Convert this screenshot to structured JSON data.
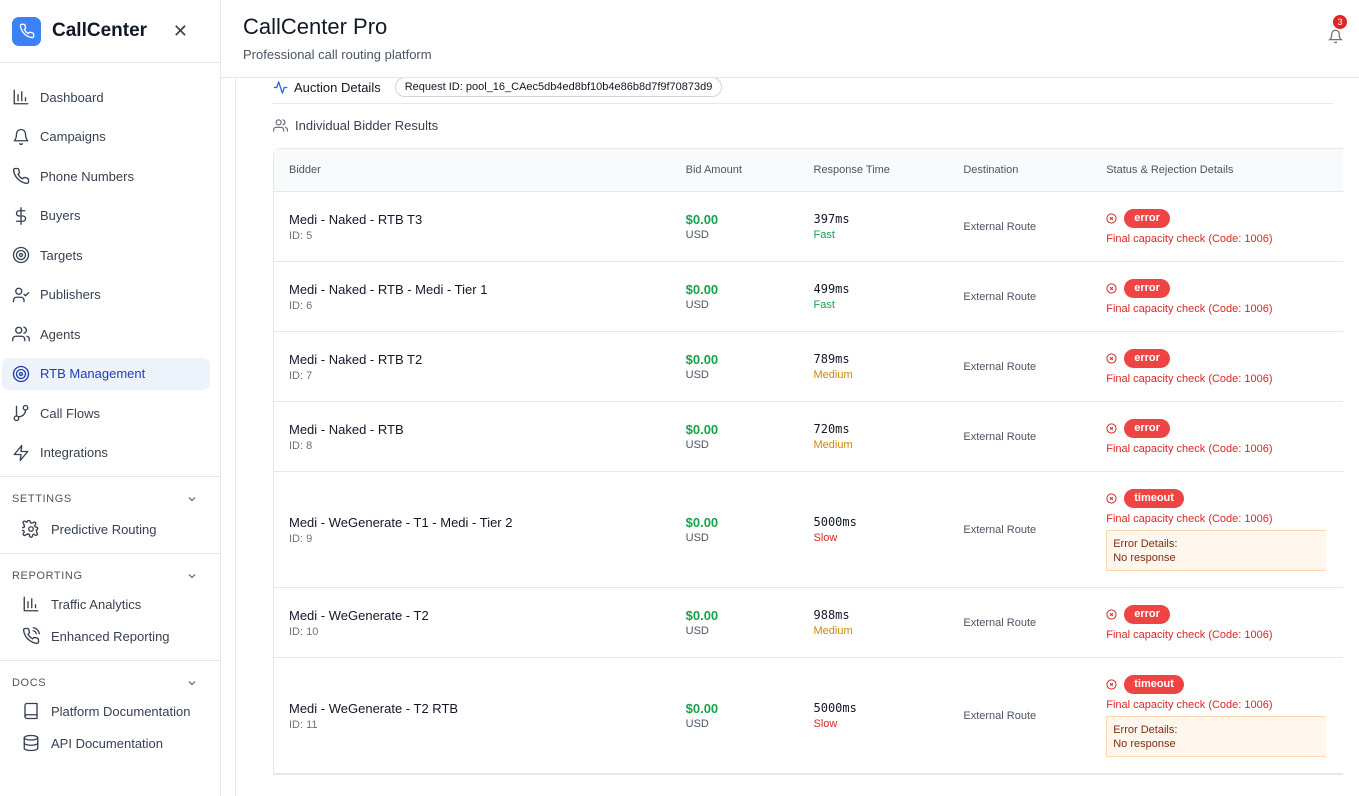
{
  "sidebar": {
    "brand": "CallCenter",
    "nav": [
      {
        "label": "Dashboard",
        "icon": "bar-chart-icon",
        "active": false
      },
      {
        "label": "Campaigns",
        "icon": "bell-icon",
        "active": false
      },
      {
        "label": "Phone Numbers",
        "icon": "phone-icon",
        "active": false
      },
      {
        "label": "Buyers",
        "icon": "dollar-icon",
        "active": false
      },
      {
        "label": "Targets",
        "icon": "target-icon",
        "active": false
      },
      {
        "label": "Publishers",
        "icon": "user-check-icon",
        "active": false
      },
      {
        "label": "Agents",
        "icon": "users-icon",
        "active": false
      },
      {
        "label": "RTB Management",
        "icon": "target-icon",
        "active": true
      },
      {
        "label": "Call Flows",
        "icon": "git-branch-icon",
        "active": false
      },
      {
        "label": "Integrations",
        "icon": "zap-icon",
        "active": false
      }
    ],
    "settings": {
      "title": "SETTINGS",
      "items": [
        {
          "label": "Predictive Routing",
          "icon": "gear-icon"
        }
      ]
    },
    "reporting": {
      "title": "REPORTING",
      "items": [
        {
          "label": "Traffic Analytics",
          "icon": "bar-chart-icon"
        },
        {
          "label": "Enhanced Reporting",
          "icon": "phone-call-icon"
        }
      ]
    },
    "docs": {
      "title": "DOCS",
      "items": [
        {
          "label": "Platform Documentation",
          "icon": "book-icon"
        },
        {
          "label": "API Documentation",
          "icon": "database-icon"
        }
      ]
    }
  },
  "header": {
    "title": "CallCenter Pro",
    "subtitle": "Professional call routing platform",
    "notification_count": "3"
  },
  "auction": {
    "title": "Auction Details",
    "request_id": "Request ID: pool_16_CAec5db4ed8bf10b4e86b8d7f9f70873d9",
    "results_title": "Individual Bidder Results"
  },
  "table": {
    "columns": [
      "Bidder",
      "Bid Amount",
      "Response Time",
      "Destination",
      "Status & Rejection Details"
    ],
    "rows": [
      {
        "name": "Medi - Naked - RTB T3",
        "id": "ID: 5",
        "amount": "$0.00",
        "currency": "USD",
        "response": "397ms",
        "speed": "Fast",
        "speed_color": "#16a34a",
        "destination": "External Route",
        "status": "error",
        "reason": "Final capacity check (Code: 1006)",
        "error_details": null
      },
      {
        "name": "Medi - Naked - RTB - Medi - Tier 1",
        "id": "ID: 6",
        "amount": "$0.00",
        "currency": "USD",
        "response": "499ms",
        "speed": "Fast",
        "speed_color": "#16a34a",
        "destination": "External Route",
        "status": "error",
        "reason": "Final capacity check (Code: 1006)",
        "error_details": null
      },
      {
        "name": "Medi - Naked - RTB T2",
        "id": "ID: 7",
        "amount": "$0.00",
        "currency": "USD",
        "response": "789ms",
        "speed": "Medium",
        "speed_color": "#ca8a04",
        "destination": "External Route",
        "status": "error",
        "reason": "Final capacity check (Code: 1006)",
        "error_details": null
      },
      {
        "name": "Medi - Naked - RTB",
        "id": "ID: 8",
        "amount": "$0.00",
        "currency": "USD",
        "response": "720ms",
        "speed": "Medium",
        "speed_color": "#ca8a04",
        "destination": "External Route",
        "status": "error",
        "reason": "Final capacity check (Code: 1006)",
        "error_details": null
      },
      {
        "name": "Medi - WeGenerate - T1 - Medi - Tier 2",
        "id": "ID: 9",
        "amount": "$0.00",
        "currency": "USD",
        "response": "5000ms",
        "speed": "Slow",
        "speed_color": "#dc2626",
        "destination": "External Route",
        "status": "timeout",
        "reason": "Final capacity check (Code: 1006)",
        "error_details": {
          "title": "Error Details:",
          "text": "No response"
        }
      },
      {
        "name": "Medi - WeGenerate - T2",
        "id": "ID: 10",
        "amount": "$0.00",
        "currency": "USD",
        "response": "988ms",
        "speed": "Medium",
        "speed_color": "#ca8a04",
        "destination": "External Route",
        "status": "error",
        "reason": "Final capacity check (Code: 1006)",
        "error_details": null
      },
      {
        "name": "Medi - WeGenerate - T2 RTB",
        "id": "ID: 11",
        "amount": "$0.00",
        "currency": "USD",
        "response": "5000ms",
        "speed": "Slow",
        "speed_color": "#dc2626",
        "destination": "External Route",
        "status": "timeout",
        "reason": "Final capacity check (Code: 1006)",
        "error_details": {
          "title": "Error Details:",
          "text": "No response"
        }
      }
    ]
  }
}
